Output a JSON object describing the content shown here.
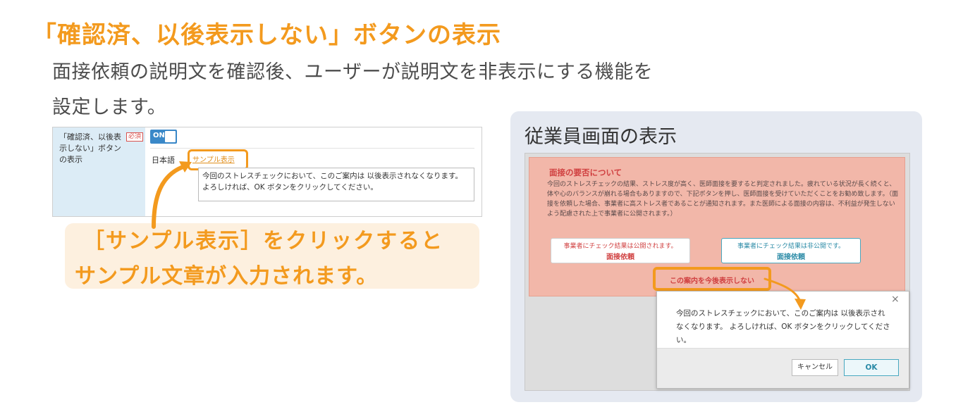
{
  "heading": "「確認済、以後表示しない」ボタンの表示",
  "description": {
    "line1": "面接依頼の説明文を確認後、ユーザーが説明文を非表示にする機能を",
    "line2": "設定します。"
  },
  "admin_panel": {
    "label": "「確認済、以後表示しない」ボタンの表示",
    "required_badge": "必須",
    "toggle_label": "ON",
    "language_label": "日本語",
    "sample_link": "サンプル表示",
    "sample_text": "今回のストレスチェックにおいて、このご案内は 以後表示されなくなります。 よろしければ、OK ボタンをクリックしてください。"
  },
  "callout": {
    "line1": "［サンプル表示］をクリックすると",
    "line2": "サンプル文章が入力されます。"
  },
  "employee_view": {
    "title": "従業員画面の表示",
    "notice_title": "面接の要否について",
    "notice_body": "今回のストレスチェックの結果、ストレス度が高く、医師面接を要すると判定されました。疲れている状況が長く続くと、体や心のバランスが崩れる場合もありますので、下記ボタンを押し、医師面接を受けていただくことをお勧め致します。（面接を依頼した場合、事業者に高ストレス者であることが通知されます。また医師による面接の内容は、不利益が発生しないよう配慮された上で事業者に公開されます。）",
    "public_button": {
      "sub": "事業者にチェック結果は公開されます。",
      "main": "面接依頼"
    },
    "private_button": {
      "sub": "事業者にチェック結果は非公開です。",
      "main": "面接依頼"
    },
    "hide_button": "この案内を今後表示しない"
  },
  "dialog": {
    "close": "×",
    "message": "今回のストレスチェックにおいて、このご案内は 以後表示されなくなります。 よろしければ、OK ボタンをクリックしてください。",
    "cancel": "キャンセル",
    "ok": "OK"
  },
  "colors": {
    "accent": "#f39a1e",
    "callout_bg": "#fdf0df",
    "card_bg": "#e5e9f1",
    "notice_bg": "#f2b7a9",
    "teal": "#2a8aa6",
    "toggle_blue": "#3a88c8"
  }
}
